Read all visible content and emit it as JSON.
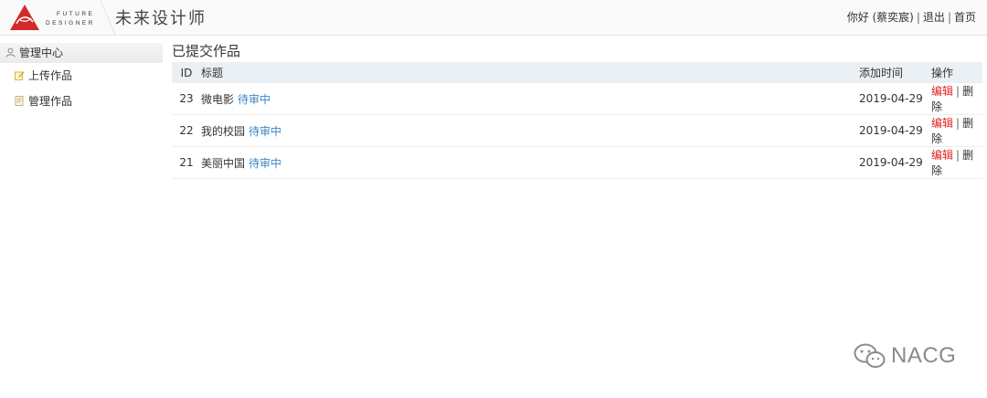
{
  "header": {
    "logo_line1": "FUTURE",
    "logo_line2": "DESIGNER",
    "title": "未来设计师",
    "greeting": "你好 (蔡奕宸)",
    "logout": "退出",
    "home": "首页",
    "separator": "|"
  },
  "sidebar": {
    "heading": "管理中心",
    "items": [
      {
        "label": "上传作品",
        "icon": "edit-icon"
      },
      {
        "label": "管理作品",
        "icon": "document-icon"
      }
    ]
  },
  "main": {
    "title": "已提交作品",
    "columns": {
      "id": "ID",
      "title": "标题",
      "date": "添加时间",
      "ops": "操作"
    },
    "rows": [
      {
        "id": "23",
        "title": "微电影",
        "status": "待审中",
        "date": "2019-04-29",
        "edit": "编辑",
        "delete": "删除"
      },
      {
        "id": "22",
        "title": "我的校园",
        "status": "待审中",
        "date": "2019-04-29",
        "edit": "编辑",
        "delete": "删除"
      },
      {
        "id": "21",
        "title": "美丽中国",
        "status": "待审中",
        "date": "2019-04-29",
        "edit": "编辑",
        "delete": "删除"
      }
    ],
    "op_separator": "|"
  },
  "watermark": {
    "text": "NACG"
  },
  "colors": {
    "accent_red": "#e02020",
    "status_blue": "#3a87c8",
    "header_bg": "#fafafa",
    "table_head_bg": "#ebf0f5"
  }
}
